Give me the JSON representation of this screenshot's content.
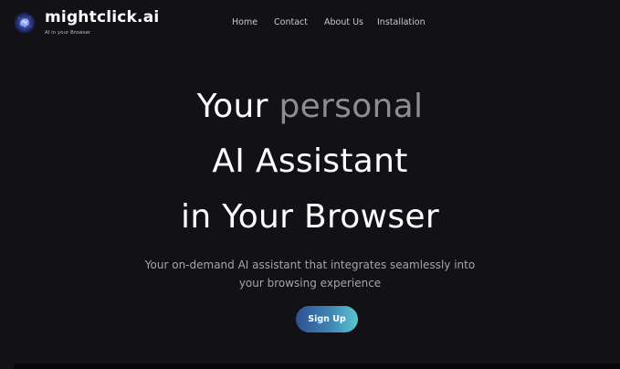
{
  "brand": {
    "name": "mightclick.ai",
    "tagline": "AI in your Browser",
    "logo_icon": "brain-globe-icon"
  },
  "nav": {
    "home": "Home",
    "contact": "Contact",
    "about": "About Us",
    "installation": "Installation"
  },
  "hero": {
    "line1_prefix": "Your ",
    "line1_accent": "personal",
    "line2": "AI Assistant",
    "line3": "in Your Browser",
    "subtitle_line1": "Your on-demand AI assistant that integrates seamlessly into",
    "subtitle_line2": "your browsing experience",
    "cta_label": "Sign Up"
  },
  "colors": {
    "background": "#111116",
    "text": "#ffffff",
    "accent_text": "#8d8d93",
    "cta_gradient_start": "#2e4f93",
    "cta_gradient_end": "#5cc6ce"
  }
}
